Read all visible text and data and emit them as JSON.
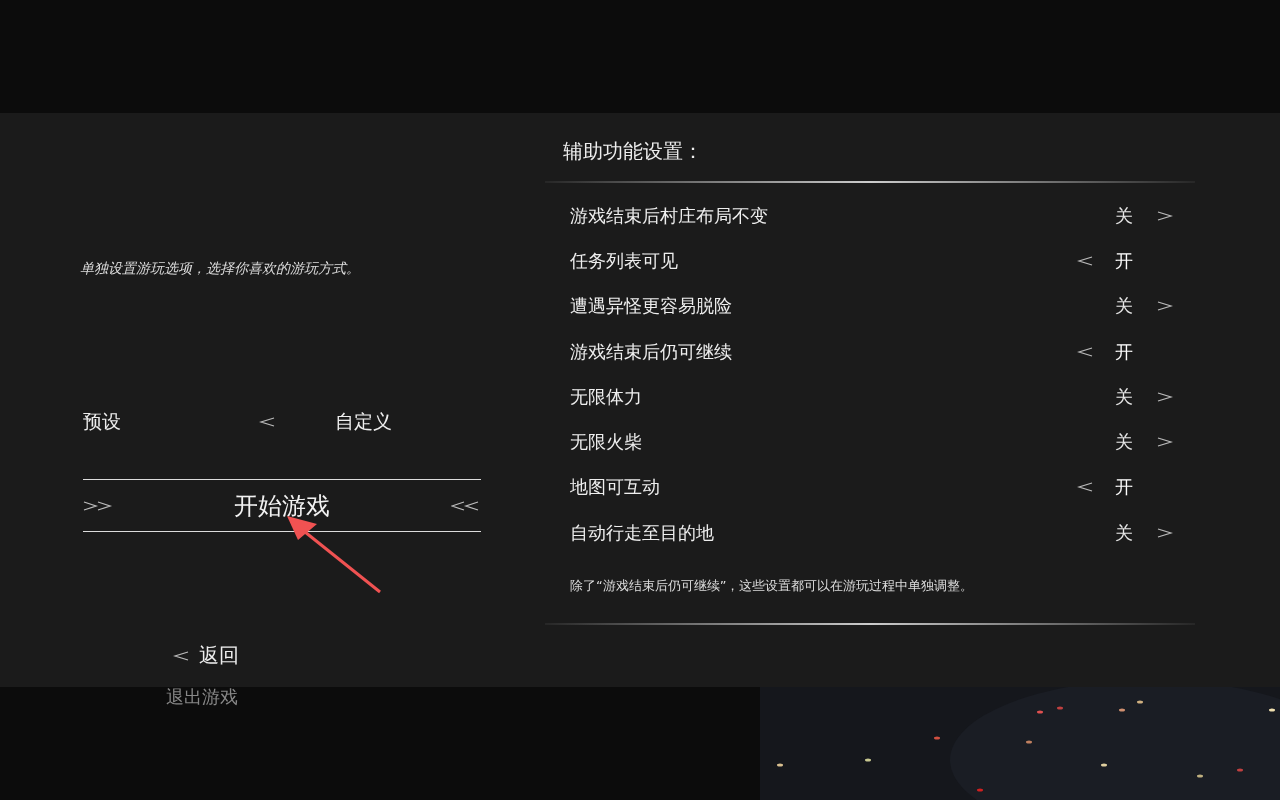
{
  "intro": "单独设置游玩选项，选择你喜欢的游玩方式。",
  "preset": {
    "label": "预设",
    "value": "自定义"
  },
  "start_button": "开始游戏",
  "back_button": "返回",
  "exit_button": "退出游戏",
  "settings": {
    "title": "辅助功能设置：",
    "rows": [
      {
        "label": "游戏结束后村庄布局不变",
        "value": "关",
        "on": false
      },
      {
        "label": "任务列表可见",
        "value": "开",
        "on": true
      },
      {
        "label": "遭遇异怪更容易脱险",
        "value": "关",
        "on": false
      },
      {
        "label": "游戏结束后仍可继续",
        "value": "开",
        "on": true
      },
      {
        "label": "无限体力",
        "value": "关",
        "on": false
      },
      {
        "label": "无限火柴",
        "value": "关",
        "on": false
      },
      {
        "label": "地图可互动",
        "value": "开",
        "on": true
      },
      {
        "label": "自动行走至目的地",
        "value": "关",
        "on": false
      }
    ],
    "note": "除了“游戏结束后仍可继续”，这些设置都可以在游玩过程中单独调整。"
  }
}
